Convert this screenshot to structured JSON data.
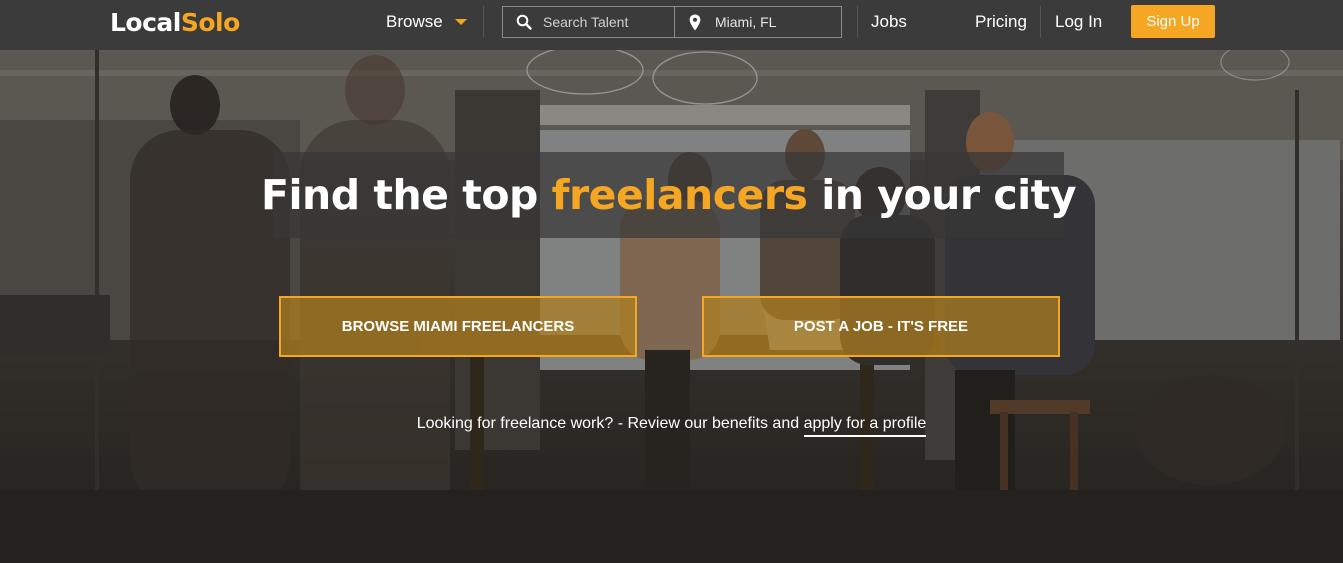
{
  "brand": {
    "logo_part1": "Local",
    "logo_part2": "Solo",
    "accent_color": "#f5a623"
  },
  "nav": {
    "browse_label": "Browse",
    "search_placeholder": "Search Talent",
    "location_value": "Miami, FL",
    "jobs_label": "Jobs",
    "pricing_label": "Pricing",
    "login_label": "Log In",
    "signup_label": "Sign Up",
    "icons": {
      "browse_caret": "caret-down-icon",
      "search": "search-icon",
      "location": "map-pin-icon"
    }
  },
  "hero": {
    "headline_part1": "Find the top ",
    "headline_highlight": "freelancers",
    "headline_part2": " in your city",
    "cta_browse": "BROWSE MIAMI FREELANCERS",
    "cta_post": "POST A JOB - IT'S FREE",
    "subline_text": "Looking for freelance work? - Review our benefits and ",
    "subline_link": "apply for a profile"
  }
}
